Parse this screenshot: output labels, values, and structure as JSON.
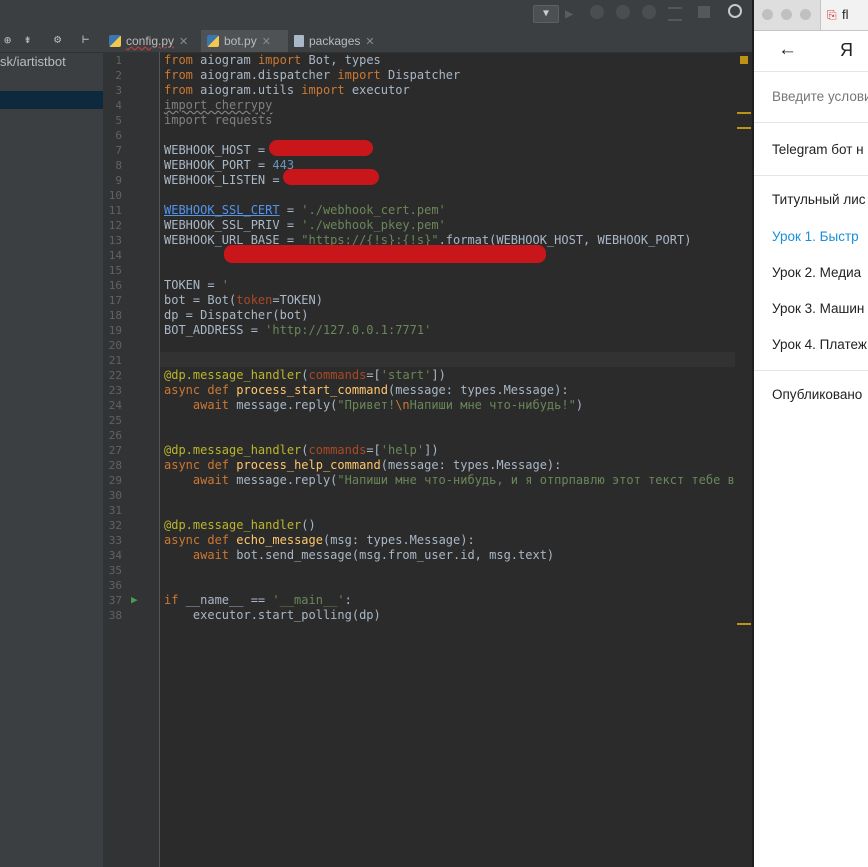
{
  "project": {
    "path": "sk/iartistbot"
  },
  "tabs": [
    {
      "label": "config.py",
      "active": false
    },
    {
      "label": "bot.py",
      "active": true
    },
    {
      "label": "packages",
      "active": false
    }
  ],
  "editor": {
    "line_numbers": [
      "1",
      "2",
      "3",
      "4",
      "5",
      "6",
      "7",
      "8",
      "9",
      "10",
      "11",
      "12",
      "13",
      "14",
      "15",
      "16",
      "17",
      "18",
      "19",
      "20",
      "21",
      "22",
      "23",
      "24",
      "25",
      "26",
      "27",
      "28",
      "29",
      "30",
      "31",
      "32",
      "33",
      "34",
      "35",
      "36",
      "37",
      "38"
    ]
  },
  "browser": {
    "back_arrow": "←",
    "logo_letter": "Я",
    "search_placeholder": "Введите услови",
    "doc_title": "Telegram бот н",
    "tab_label": "fl",
    "toc": [
      {
        "label": "Титульный лис",
        "active": false
      },
      {
        "label": "Урок 1. Быстр",
        "active": true
      },
      {
        "label": "Урок 2. Медиа",
        "active": false
      },
      {
        "label": "Урок 3. Машин",
        "active": false
      },
      {
        "label": "Урок 4. Платеж",
        "active": false
      }
    ],
    "footer": "Опубликовано"
  },
  "colors": {
    "keyword": "#cc7832",
    "string": "#6a8759",
    "number": "#6897bb",
    "decorator": "#bbb529",
    "link": "#1a8fd8"
  }
}
